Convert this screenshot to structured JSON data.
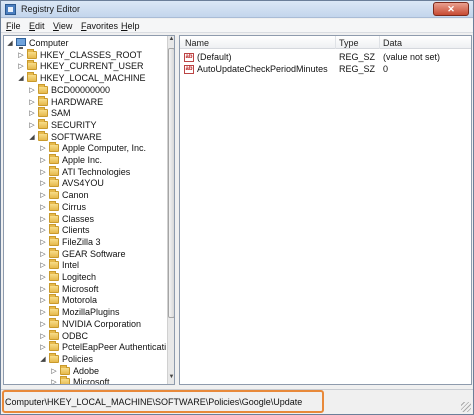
{
  "window": {
    "title": "Registry Editor",
    "close_label": "✕"
  },
  "menu": [
    "File",
    "Edit",
    "View",
    "Favorites",
    "Help"
  ],
  "tree": [
    {
      "label": "Computer",
      "depth": 0,
      "expanded": true,
      "kind": "pc"
    },
    {
      "label": "HKEY_CLASSES_ROOT",
      "depth": 1,
      "expanded": false
    },
    {
      "label": "HKEY_CURRENT_USER",
      "depth": 1,
      "expanded": false
    },
    {
      "label": "HKEY_LOCAL_MACHINE",
      "depth": 1,
      "expanded": true
    },
    {
      "label": "BCD00000000",
      "depth": 2,
      "expanded": false
    },
    {
      "label": "HARDWARE",
      "depth": 2,
      "expanded": false
    },
    {
      "label": "SAM",
      "depth": 2,
      "expanded": false
    },
    {
      "label": "SECURITY",
      "depth": 2,
      "expanded": false
    },
    {
      "label": "SOFTWARE",
      "depth": 2,
      "expanded": true
    },
    {
      "label": "Apple Computer, Inc.",
      "depth": 3,
      "expanded": false
    },
    {
      "label": "Apple Inc.",
      "depth": 3,
      "expanded": false
    },
    {
      "label": "ATI Technologies",
      "depth": 3,
      "expanded": false
    },
    {
      "label": "AVS4YOU",
      "depth": 3,
      "expanded": false
    },
    {
      "label": "Canon",
      "depth": 3,
      "expanded": false
    },
    {
      "label": "Cirrus",
      "depth": 3,
      "expanded": false
    },
    {
      "label": "Classes",
      "depth": 3,
      "expanded": false
    },
    {
      "label": "Clients",
      "depth": 3,
      "expanded": false
    },
    {
      "label": "FileZilla 3",
      "depth": 3,
      "expanded": false
    },
    {
      "label": "GEAR Software",
      "depth": 3,
      "expanded": false
    },
    {
      "label": "Intel",
      "depth": 3,
      "expanded": false
    },
    {
      "label": "Logitech",
      "depth": 3,
      "expanded": false
    },
    {
      "label": "Microsoft",
      "depth": 3,
      "expanded": false
    },
    {
      "label": "Motorola",
      "depth": 3,
      "expanded": false
    },
    {
      "label": "MozillaPlugins",
      "depth": 3,
      "expanded": false
    },
    {
      "label": "NVIDIA Corporation",
      "depth": 3,
      "expanded": false
    },
    {
      "label": "ODBC",
      "depth": 3,
      "expanded": false
    },
    {
      "label": "PctelEapPeer Authenticati",
      "depth": 3,
      "expanded": false
    },
    {
      "label": "Policies",
      "depth": 3,
      "expanded": true
    },
    {
      "label": "Adobe",
      "depth": 4,
      "expanded": false
    },
    {
      "label": "Microsoft",
      "depth": 4,
      "expanded": false
    }
  ],
  "list": {
    "columns": [
      "Name",
      "Type",
      "Data"
    ],
    "rows": [
      {
        "name": "(Default)",
        "type": "REG_SZ",
        "data": "(value not set)",
        "icon": "string-value-icon"
      },
      {
        "name": "AutoUpdateCheckPeriodMinutes",
        "type": "REG_SZ",
        "data": "0",
        "icon": "string-value-icon"
      }
    ]
  },
  "status": {
    "path": "Computer\\HKEY_LOCAL_MACHINE\\SOFTWARE\\Policies\\Google\\Update"
  },
  "colors": {
    "highlight": "#e8893a",
    "folder": "#e6b94c"
  }
}
